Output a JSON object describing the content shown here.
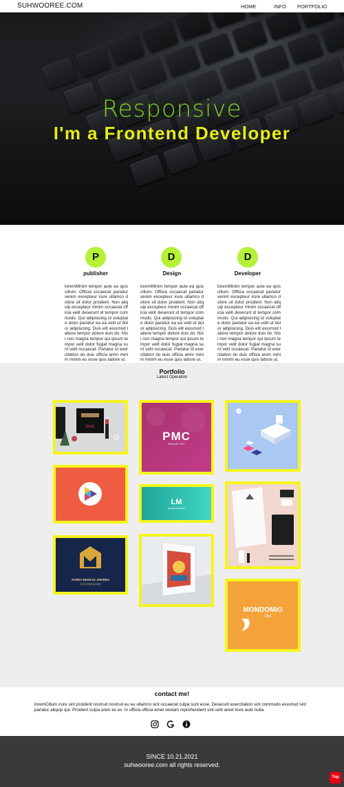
{
  "nav": {
    "brand": "SUHWOOREE.COM",
    "links": [
      "HOME",
      "INFO",
      "PORTFOLIO"
    ]
  },
  "hero": {
    "subtitle": "Responsive",
    "title": "I'm a Frontend Developer"
  },
  "features": [
    {
      "letter": "P",
      "title": "publisher",
      "text": "loremMinim tempor aute ea quis cillum. Officia occaecat pariatur venim excepteur irure ullamco dolore sit dolor proident. Non aliquip excepteur minim occaecat officia velit deserunt id tempor commodo. Qui adipisicing id voluptate dolor pariatur ea ea velit ut dolor adipisicing. Duis elit eiusmod labore tempor dolore duis do. Nisi non magna tempor qui ipsum tempor velit dolor fugiat magna sunt velit occaecat. Pariatur id exercitation do duis officia anim minim minim eu esse quis labore ut."
    },
    {
      "letter": "D",
      "title": "Design",
      "text": "loremMinim tempor aute ea quis cillum. Officia occaecat pariatur venim excepteur irure ullamco dolore sit dolor proident. Non aliquip excepteur minim occaecat officia velit deserunt id tempor commodo. Qui adipisicing id voluptate dolor pariatur ea ea velit ut dolor adipisicing. Duis elit eiusmod labore tempor dolore duis do. Nisi non magna tempor qui ipsum tempor velit dolor fugiat magna sunt velit occaecat. Pariatur id exercitation do duis officia anim minim minim eu esse quis labore ut."
    },
    {
      "letter": "D",
      "title": "Developer",
      "text": "loremMinim tempor aute ea quis cillum. Officia occaecat pariatur venim excepteur irure ullamco dolore sit dolor proident. Non aliquip excepteur minim occaecat officia velit deserunt id tempor commodo. Qui adipisicing id voluptate dolor pariatur ea ea velit ut dolor adipisicing. Duis elit eiusmod labore tempor dolore duis do. Nisi non magna tempor qui ipsum tempor velit dolor fugiat magna sunt velit occaecat. Pariatur id exercitation do duis officia anim minim minim eu esse quis labore ut."
    }
  ],
  "portfolio": {
    "title": "Portfolio",
    "subtitle": "Latest Operation",
    "tiles": {
      "pmc": {
        "logo": "PMC",
        "tag": "PLAY MY CITY"
      },
      "lm": {
        "logo": "LM",
        "tag": "ENTERTAINMENT"
      },
      "kma": {
        "logo": "KOREA MUSICAL AWARDS",
        "sub": "제1회 한국뮤지컬어워즈"
      },
      "mondo": {
        "logo": "MONDOMIO",
        "sub": "Pet"
      }
    }
  },
  "contact": {
    "title": "contact me!",
    "text": "loremCillum irure sint proident nostrud nostrud eu eu ullamco sint occaecat culpa sunt esse. Deserunt exercitation sint commodo eiusmod sint pariatur aliquip qui. Proident culpa anim ex ex. In officia officia amet veniam reprehenderit sint velit amet irure aute nulla."
  },
  "footer": {
    "since": "SINCE 10.21.2021",
    "rights": "suhwooree.com all rights reserved.",
    "top_label": "Top"
  },
  "colors": {
    "accent_green": "#b5f236",
    "hero_green": "#7ed321",
    "hero_yellow": "#e6ec18",
    "tile_border": "#f5f51a",
    "top_button": "#e60012"
  }
}
